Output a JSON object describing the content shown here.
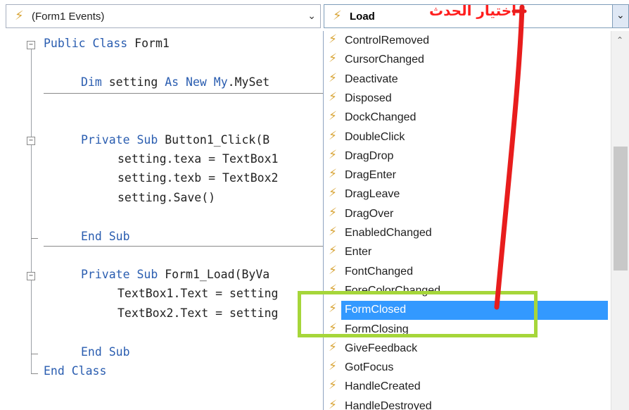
{
  "object_combo": {
    "value": "(Form1 Events)",
    "icon": "lightning-icon"
  },
  "event_combo": {
    "value": "Load",
    "icon": "lightning-icon"
  },
  "annotation": {
    "text": "اختيار الحدث",
    "color": "#ff1e1e",
    "box_color": "#a6d63a"
  },
  "code": {
    "line1": {
      "kw": "Public Class",
      "rest": " Form1"
    },
    "line2": {
      "kw1": "Dim",
      "mid1": " setting ",
      "kw2": "As New",
      "mid2": " ",
      "kw3": "My",
      "rest": ".MySet"
    },
    "line3": {
      "kw": "Private Sub",
      "rest": " Button1_Click(B"
    },
    "line4": {
      "text": "setting.texa = TextBox1"
    },
    "line5": {
      "text": "setting.texb = TextBox2"
    },
    "line6": {
      "text": "setting.Save()"
    },
    "line7": {
      "kw": "End Sub"
    },
    "line8": {
      "kw": "Private Sub",
      "rest": " Form1_Load(ByVa"
    },
    "line9": {
      "text": "TextBox1.Text = setting"
    },
    "line10": {
      "text": "TextBox2.Text = setting"
    },
    "line11": {
      "kw": "End Sub"
    },
    "line12": {
      "kw": "End Class"
    }
  },
  "events": [
    "ControlRemoved",
    "CursorChanged",
    "Deactivate",
    "Disposed",
    "DockChanged",
    "DoubleClick",
    "DragDrop",
    "DragEnter",
    "DragLeave",
    "DragOver",
    "EnabledChanged",
    "Enter",
    "FontChanged",
    "ForeColorChanged",
    "FormClosed",
    "FormClosing",
    "GiveFeedback",
    "GotFocus",
    "HandleCreated",
    "HandleDestroyed"
  ],
  "selected_event": "FormClosed",
  "colors": {
    "selection": "#3399ff",
    "keyword": "#2a5db0",
    "bolt": "#d9a63a"
  }
}
